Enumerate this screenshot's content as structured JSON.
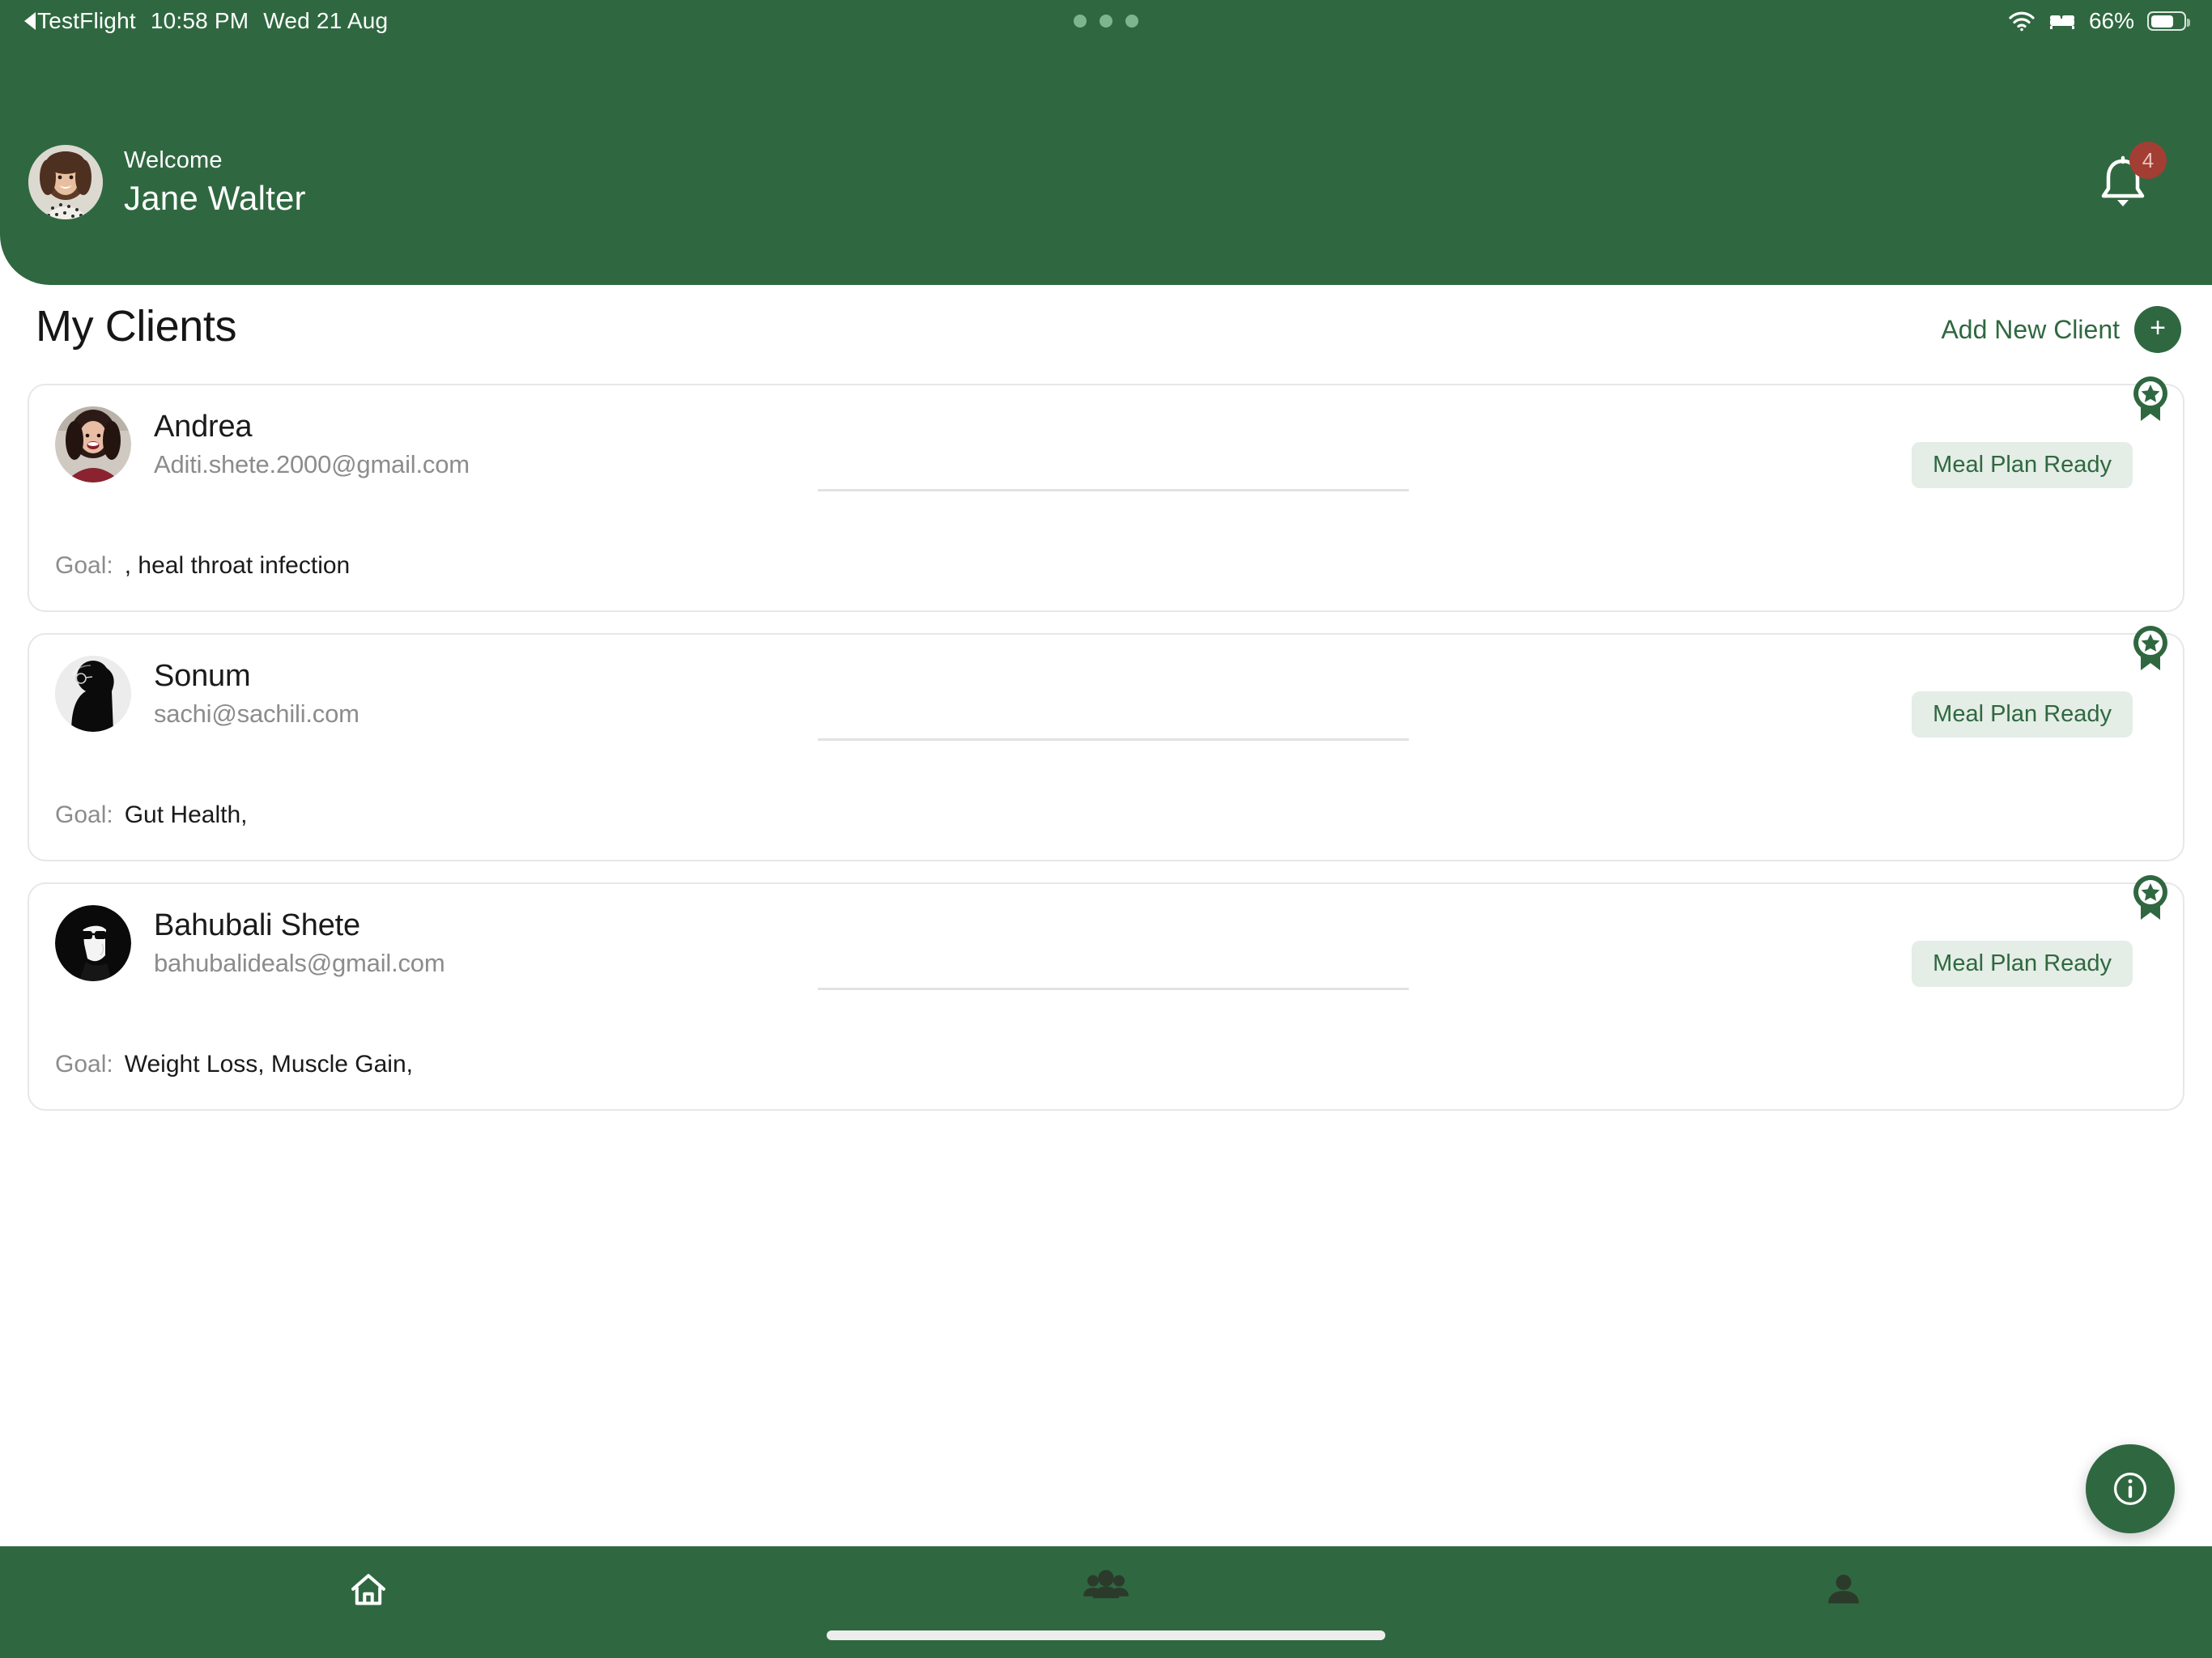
{
  "status_bar": {
    "back_app": "TestFlight",
    "time": "10:58 PM",
    "date": "Wed 21 Aug",
    "battery_percent": "66%",
    "icons": [
      "back-caret-icon",
      "wifi-icon",
      "bed-focus-icon",
      "battery-icon"
    ]
  },
  "header": {
    "welcome_label": "Welcome",
    "user_name": "Jane Walter",
    "notification_count": "4",
    "brand_green": "#2F6840"
  },
  "page": {
    "title": "My Clients",
    "add_new_client_label": "Add New Client",
    "add_new_client_plus": "+"
  },
  "clients": [
    {
      "name": "Andrea",
      "email": "Aditi.shete.2000@gmail.com",
      "goal_label": "Goal:",
      "goal_value": ", heal throat infection",
      "status": "Meal Plan Ready",
      "avatar_colors": [
        "#8a2230",
        "#c98f84",
        "#3a2420"
      ]
    },
    {
      "name": "Sonum",
      "email": "sachi@sachili.com",
      "goal_label": "Goal:",
      "goal_value": "Gut Health,",
      "status": "Meal Plan Ready",
      "avatar_colors": [
        "#0b0b0b",
        "#e9e9e9",
        "#0b0b0b"
      ]
    },
    {
      "name": "Bahubali Shete",
      "email": "bahubalideals@gmail.com",
      "goal_label": "Goal:",
      "goal_value": "Weight Loss, Muscle Gain,",
      "status": "Meal Plan Ready",
      "avatar_colors": [
        "#090909",
        "#f2f2f2",
        "#090909"
      ]
    }
  ],
  "fab": {
    "icon": "info-icon"
  },
  "bottom_nav": {
    "items": [
      {
        "icon": "home-icon",
        "active": true
      },
      {
        "icon": "people-group-icon",
        "active": false
      },
      {
        "icon": "person-icon",
        "active": false
      }
    ],
    "active_color": "#FFFFFF",
    "inactive_color": "#2B3A2B"
  }
}
